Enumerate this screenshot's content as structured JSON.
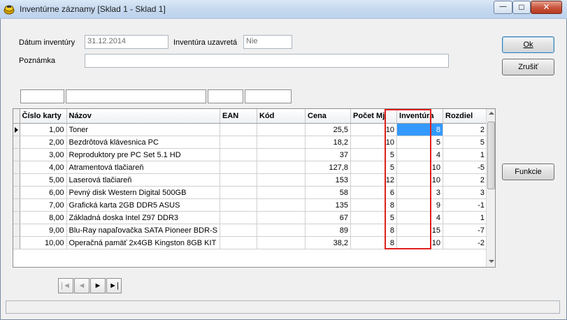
{
  "window": {
    "title": "Inventúrne záznamy [Sklad 1 - Sklad 1]",
    "minimize_glyph": "—",
    "maximize_glyph": "□",
    "close_glyph": "✕"
  },
  "form": {
    "date_label": "Dátum inventúry",
    "date_value": "31.12.2014",
    "closed_label": "Inventúra uzavretá",
    "closed_value": "Nie",
    "note_label": "Poznámka",
    "note_value": ""
  },
  "buttons": {
    "ok": "Ok",
    "cancel": "Zrušiť",
    "functions": "Funkcie"
  },
  "grid": {
    "columns": [
      "Číslo karty",
      "Názov",
      "EAN",
      "Kód",
      "Cena",
      "Počet Mj",
      "Inventúra",
      "Rozdiel"
    ],
    "rows": [
      {
        "card": "1,00",
        "name": "Toner",
        "ean": "",
        "code": "",
        "price": "25,5",
        "qty": "10",
        "inv": "8",
        "diff": "2"
      },
      {
        "card": "2,00",
        "name": "Bezdrôtová klávesnica PC",
        "ean": "",
        "code": "",
        "price": "18,2",
        "qty": "10",
        "inv": "5",
        "diff": "5"
      },
      {
        "card": "3,00",
        "name": "Reproduktory pre PC Set 5.1 HD",
        "ean": "",
        "code": "",
        "price": "37",
        "qty": "5",
        "inv": "4",
        "diff": "1"
      },
      {
        "card": "4,00",
        "name": "Atramentová tlačiareň",
        "ean": "",
        "code": "",
        "price": "127,8",
        "qty": "5",
        "inv": "10",
        "diff": "-5"
      },
      {
        "card": "5,00",
        "name": "Laserová tlačiareň",
        "ean": "",
        "code": "",
        "price": "153",
        "qty": "12",
        "inv": "10",
        "diff": "2"
      },
      {
        "card": "6,00",
        "name": "Pevný disk Western Digital 500GB",
        "ean": "",
        "code": "",
        "price": "58",
        "qty": "6",
        "inv": "3",
        "diff": "3"
      },
      {
        "card": "7,00",
        "name": "Grafická karta 2GB DDR5 ASUS",
        "ean": "",
        "code": "",
        "price": "135",
        "qty": "8",
        "inv": "9",
        "diff": "-1"
      },
      {
        "card": "8,00",
        "name": "Základná doska Intel Z97 DDR3",
        "ean": "",
        "code": "",
        "price": "67",
        "qty": "5",
        "inv": "4",
        "diff": "1"
      },
      {
        "card": "9,00",
        "name": "Blu-Ray napaľovačka SATA Pioneer BDR-S",
        "ean": "",
        "code": "",
        "price": "89",
        "qty": "8",
        "inv": "15",
        "diff": "-7"
      },
      {
        "card": "10,00",
        "name": "Operačná pamäť 2x4GB Kingston 8GB KIT",
        "ean": "",
        "code": "",
        "price": "38,2",
        "qty": "8",
        "inv": "10",
        "diff": "-2"
      }
    ],
    "selected_row": 0,
    "selected_column": "Inventúra"
  },
  "navigation": {
    "first": "|◄",
    "prev": "◄",
    "next": "►",
    "last": "►|"
  },
  "colors": {
    "highlight_box": "#e0201e",
    "selection": "#3399ff"
  }
}
